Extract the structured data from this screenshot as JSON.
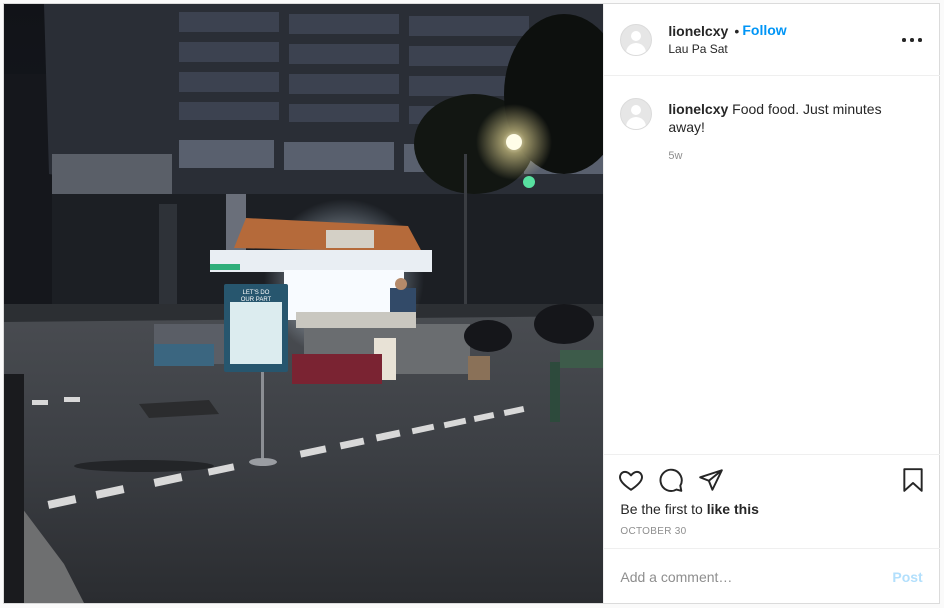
{
  "post": {
    "username": "lionelcxy",
    "separator": "•",
    "follow_label": "Follow",
    "location": "Lau Pa Sat",
    "more_icon": "more-options-icon"
  },
  "photo": {
    "alt": "Night street view of a hawker food stall at Lau Pa Sat",
    "sign_line1": "LET'S DO",
    "sign_line2": "OUR PART"
  },
  "caption": {
    "username": "lionelcxy",
    "text": "Food food. Just minutes away!",
    "time": "5w"
  },
  "actions": {
    "icons": [
      "heart-icon",
      "comment-icon",
      "share-icon",
      "bookmark-icon"
    ],
    "likes_prefix": "Be the first to ",
    "likes_bold": "like this",
    "date": "OCTOBER 30"
  },
  "comment": {
    "placeholder": "Add a comment…",
    "post_label": "Post"
  },
  "colors": {
    "link_blue": "#0095f6",
    "post_disabled": "#b2dffc",
    "text": "#262626",
    "muted": "#8e8e8e",
    "border": "#efefef"
  }
}
